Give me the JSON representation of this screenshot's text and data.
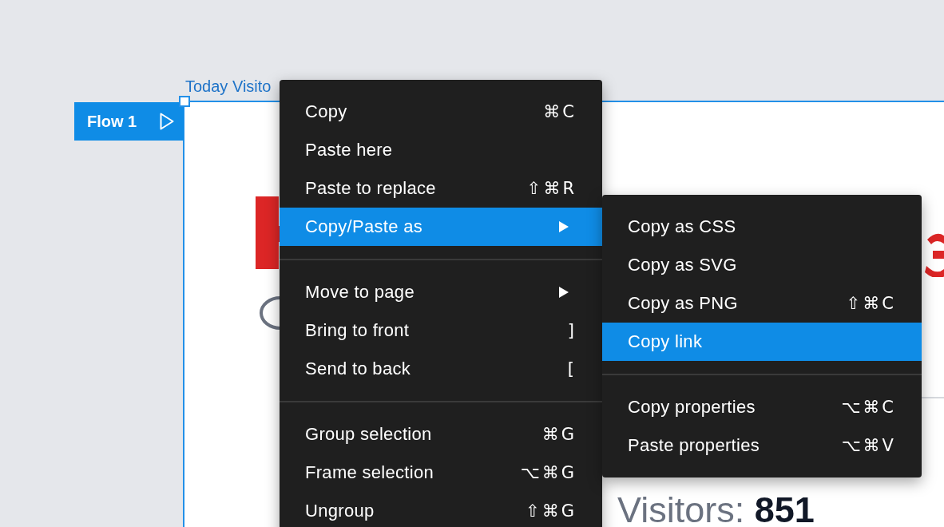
{
  "canvas": {
    "frame_label": "Today Visito",
    "flow_tag": {
      "label": "Flow 1"
    },
    "frame_texts": [
      {
        "kind": "stat",
        "label": "Visitors:",
        "value": "851"
      }
    ]
  },
  "context_menu": {
    "groups": [
      [
        {
          "label": "Copy",
          "shortcut": "⌘C",
          "submenu": false,
          "selected": false
        },
        {
          "label": "Paste here",
          "submenu": false,
          "selected": false
        },
        {
          "label": "Paste to replace",
          "shortcut": "⇧⌘R",
          "submenu": false,
          "selected": false
        },
        {
          "label": "Copy/Paste as",
          "submenu": true,
          "selected": true
        }
      ],
      [
        {
          "label": "Move to page",
          "submenu": true,
          "selected": false
        },
        {
          "label": "Bring to front",
          "shortcut": "]",
          "submenu": false,
          "selected": false
        },
        {
          "label": "Send to back",
          "shortcut": "[",
          "submenu": false,
          "selected": false
        }
      ],
      [
        {
          "label": "Group selection",
          "shortcut": "⌘G",
          "submenu": false,
          "selected": false
        },
        {
          "label": "Frame selection",
          "shortcut": "⌥⌘G",
          "submenu": false,
          "selected": false
        },
        {
          "label": "Ungroup",
          "shortcut": "⇧⌘G",
          "submenu": false,
          "selected": false
        }
      ]
    ]
  },
  "submenu": {
    "groups": [
      [
        {
          "label": "Copy as CSS",
          "submenu": false,
          "selected": false
        },
        {
          "label": "Copy as SVG",
          "submenu": false,
          "selected": false
        },
        {
          "label": "Copy as PNG",
          "shortcut": "⇧⌘C",
          "submenu": false,
          "selected": false
        },
        {
          "label": "Copy link",
          "submenu": false,
          "selected": true
        }
      ],
      [
        {
          "label": "Copy properties",
          "shortcut": "⌥⌘C",
          "submenu": false,
          "selected": false
        },
        {
          "label": "Paste properties",
          "shortcut": "⌥⌘V",
          "submenu": false,
          "selected": false
        }
      ]
    ]
  }
}
